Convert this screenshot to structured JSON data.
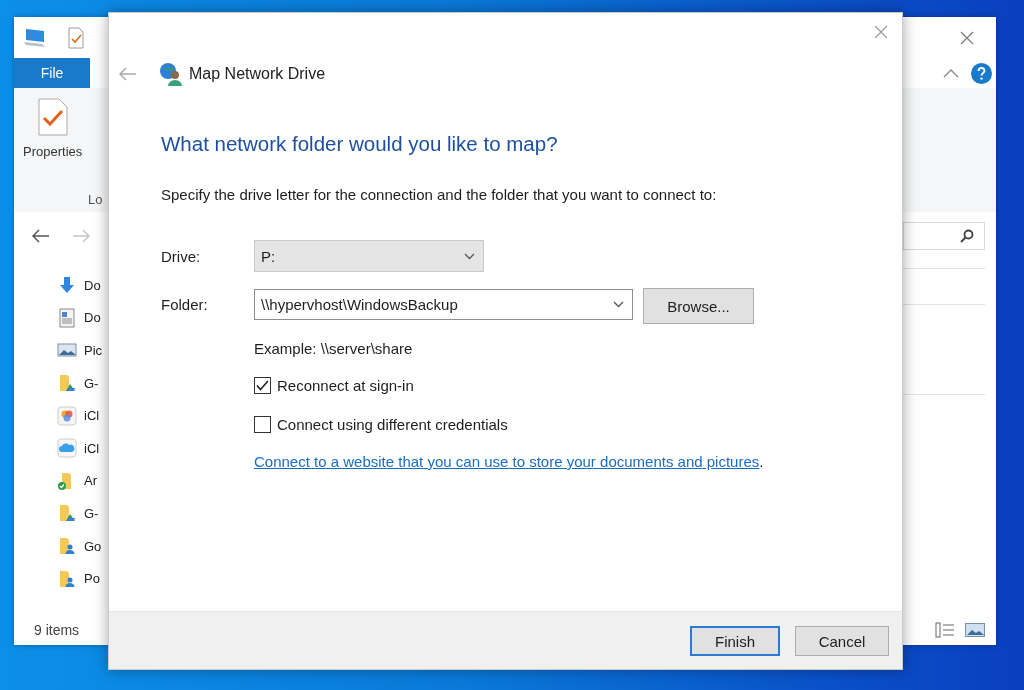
{
  "explorer": {
    "ribbon_tabs": [
      {
        "label": "File",
        "selected": true
      }
    ],
    "ribbon_buttons": [
      {
        "label": "Properties"
      }
    ],
    "group_label": "Lo",
    "nav_items": [
      {
        "label": "Do",
        "kind": "download"
      },
      {
        "label": "Do",
        "kind": "document"
      },
      {
        "label": "Pic",
        "kind": "pictures"
      },
      {
        "label": "G-",
        "kind": "drive-folder"
      },
      {
        "label": "iCl",
        "kind": "photos"
      },
      {
        "label": "iCl",
        "kind": "cloud"
      },
      {
        "label": "Ar",
        "kind": "synced-folder"
      },
      {
        "label": "G-",
        "kind": "drive-folder"
      },
      {
        "label": "Go",
        "kind": "user-folder"
      },
      {
        "label": "Po",
        "kind": "user-folder"
      }
    ],
    "status": "9 items"
  },
  "dialog": {
    "title": "Map Network Drive",
    "heading": "What network folder would you like to map?",
    "instruction": "Specify the drive letter for the connection and the folder that you want to connect to:",
    "fields": [
      {
        "kind": "dropdown",
        "label": "Drive:",
        "value": "P:"
      },
      {
        "kind": "combo",
        "label": "Folder:",
        "value": "\\\\hypervhost\\WindowsBackup",
        "button": "Browse..."
      }
    ],
    "example": "Example: \\\\server\\share",
    "options": [
      {
        "label": "Reconnect at sign-in",
        "checked": true
      },
      {
        "label": "Connect using different credentials",
        "checked": false
      }
    ],
    "link": "Connect to a website that you can use to store your documents and pictures",
    "link_end": ".",
    "buttons": [
      {
        "label": "Finish",
        "default": true
      },
      {
        "label": "Cancel",
        "default": false
      }
    ]
  }
}
